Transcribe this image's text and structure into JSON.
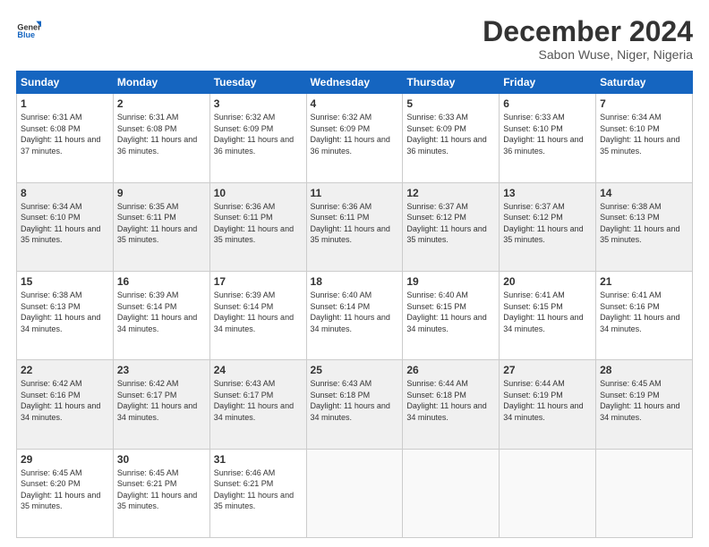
{
  "logo": {
    "general": "General",
    "blue": "Blue"
  },
  "title": "December 2024",
  "subtitle": "Sabon Wuse, Niger, Nigeria",
  "days_of_week": [
    "Sunday",
    "Monday",
    "Tuesday",
    "Wednesday",
    "Thursday",
    "Friday",
    "Saturday"
  ],
  "weeks": [
    [
      {
        "day": "1",
        "sunrise": "6:31 AM",
        "sunset": "6:08 PM",
        "daylight": "11 hours and 37 minutes."
      },
      {
        "day": "2",
        "sunrise": "6:31 AM",
        "sunset": "6:08 PM",
        "daylight": "11 hours and 36 minutes."
      },
      {
        "day": "3",
        "sunrise": "6:32 AM",
        "sunset": "6:09 PM",
        "daylight": "11 hours and 36 minutes."
      },
      {
        "day": "4",
        "sunrise": "6:32 AM",
        "sunset": "6:09 PM",
        "daylight": "11 hours and 36 minutes."
      },
      {
        "day": "5",
        "sunrise": "6:33 AM",
        "sunset": "6:09 PM",
        "daylight": "11 hours and 36 minutes."
      },
      {
        "day": "6",
        "sunrise": "6:33 AM",
        "sunset": "6:10 PM",
        "daylight": "11 hours and 36 minutes."
      },
      {
        "day": "7",
        "sunrise": "6:34 AM",
        "sunset": "6:10 PM",
        "daylight": "11 hours and 35 minutes."
      }
    ],
    [
      {
        "day": "8",
        "sunrise": "6:34 AM",
        "sunset": "6:10 PM",
        "daylight": "11 hours and 35 minutes."
      },
      {
        "day": "9",
        "sunrise": "6:35 AM",
        "sunset": "6:11 PM",
        "daylight": "11 hours and 35 minutes."
      },
      {
        "day": "10",
        "sunrise": "6:36 AM",
        "sunset": "6:11 PM",
        "daylight": "11 hours and 35 minutes."
      },
      {
        "day": "11",
        "sunrise": "6:36 AM",
        "sunset": "6:11 PM",
        "daylight": "11 hours and 35 minutes."
      },
      {
        "day": "12",
        "sunrise": "6:37 AM",
        "sunset": "6:12 PM",
        "daylight": "11 hours and 35 minutes."
      },
      {
        "day": "13",
        "sunrise": "6:37 AM",
        "sunset": "6:12 PM",
        "daylight": "11 hours and 35 minutes."
      },
      {
        "day": "14",
        "sunrise": "6:38 AM",
        "sunset": "6:13 PM",
        "daylight": "11 hours and 35 minutes."
      }
    ],
    [
      {
        "day": "15",
        "sunrise": "6:38 AM",
        "sunset": "6:13 PM",
        "daylight": "11 hours and 34 minutes."
      },
      {
        "day": "16",
        "sunrise": "6:39 AM",
        "sunset": "6:14 PM",
        "daylight": "11 hours and 34 minutes."
      },
      {
        "day": "17",
        "sunrise": "6:39 AM",
        "sunset": "6:14 PM",
        "daylight": "11 hours and 34 minutes."
      },
      {
        "day": "18",
        "sunrise": "6:40 AM",
        "sunset": "6:14 PM",
        "daylight": "11 hours and 34 minutes."
      },
      {
        "day": "19",
        "sunrise": "6:40 AM",
        "sunset": "6:15 PM",
        "daylight": "11 hours and 34 minutes."
      },
      {
        "day": "20",
        "sunrise": "6:41 AM",
        "sunset": "6:15 PM",
        "daylight": "11 hours and 34 minutes."
      },
      {
        "day": "21",
        "sunrise": "6:41 AM",
        "sunset": "6:16 PM",
        "daylight": "11 hours and 34 minutes."
      }
    ],
    [
      {
        "day": "22",
        "sunrise": "6:42 AM",
        "sunset": "6:16 PM",
        "daylight": "11 hours and 34 minutes."
      },
      {
        "day": "23",
        "sunrise": "6:42 AM",
        "sunset": "6:17 PM",
        "daylight": "11 hours and 34 minutes."
      },
      {
        "day": "24",
        "sunrise": "6:43 AM",
        "sunset": "6:17 PM",
        "daylight": "11 hours and 34 minutes."
      },
      {
        "day": "25",
        "sunrise": "6:43 AM",
        "sunset": "6:18 PM",
        "daylight": "11 hours and 34 minutes."
      },
      {
        "day": "26",
        "sunrise": "6:44 AM",
        "sunset": "6:18 PM",
        "daylight": "11 hours and 34 minutes."
      },
      {
        "day": "27",
        "sunrise": "6:44 AM",
        "sunset": "6:19 PM",
        "daylight": "11 hours and 34 minutes."
      },
      {
        "day": "28",
        "sunrise": "6:45 AM",
        "sunset": "6:19 PM",
        "daylight": "11 hours and 34 minutes."
      }
    ],
    [
      {
        "day": "29",
        "sunrise": "6:45 AM",
        "sunset": "6:20 PM",
        "daylight": "11 hours and 35 minutes."
      },
      {
        "day": "30",
        "sunrise": "6:45 AM",
        "sunset": "6:21 PM",
        "daylight": "11 hours and 35 minutes."
      },
      {
        "day": "31",
        "sunrise": "6:46 AM",
        "sunset": "6:21 PM",
        "daylight": "11 hours and 35 minutes."
      },
      null,
      null,
      null,
      null
    ]
  ]
}
